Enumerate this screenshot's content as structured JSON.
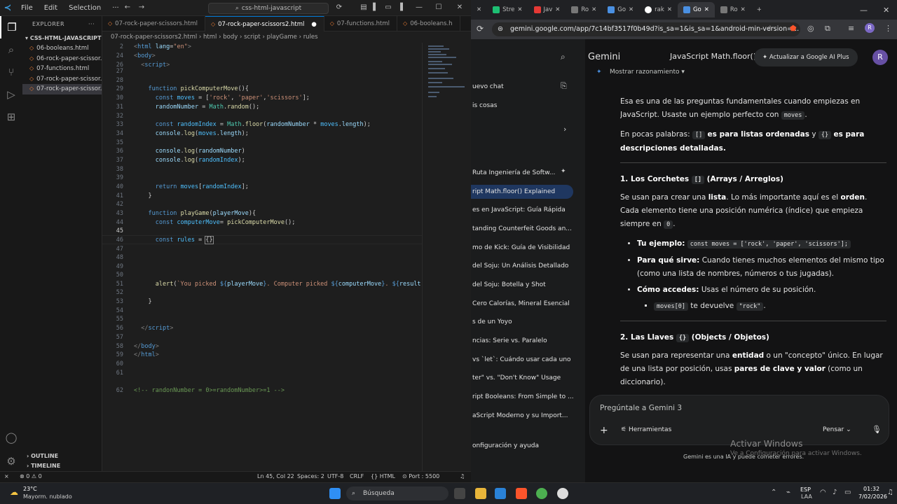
{
  "vscode": {
    "menu": [
      "File",
      "Edit",
      "Selection",
      "···"
    ],
    "search": "css-html-javascript",
    "explorer": {
      "header": "EXPLORER",
      "folder": "CSS-HTML-JAVASCRIPT",
      "files": [
        "06-booleans.html",
        "06-rock-paper-scissor...",
        "07-functions.html",
        "07-rock-paper-scissor...",
        "07-rock-paper-scissor..."
      ],
      "outline": "OUTLINE",
      "timeline": "TIMELINE"
    },
    "tabs": [
      "07-rock-paper-scissors.html",
      "07-rock-paper-scissors2.html",
      "07-functions.html",
      "06-booleans.h"
    ],
    "breadcrumb": [
      "07-rock-paper-scissors2.html",
      "html",
      "body",
      "script",
      "playGame",
      "rules"
    ],
    "line_numbers": [
      "2",
      "24",
      "26",
      "27",
      "28",
      "29",
      "30",
      "31",
      "32",
      "33",
      "34",
      "35",
      "36",
      "37",
      "38",
      "39",
      "40",
      "41",
      "42",
      "43",
      "44",
      "45",
      "46",
      "47",
      "48",
      "49",
      "50",
      "51",
      "52",
      "53",
      "54",
      "55",
      "56",
      "57",
      "58",
      "59",
      "60",
      "61",
      "62"
    ],
    "current_line": "45",
    "status": {
      "errors": "⊗ 0 ⚠ 0",
      "position": "Ln 45, Col 22",
      "spaces": "Spaces: 2",
      "encoding": "UTF-8",
      "eol": "CRLF",
      "language": "{} HTML",
      "port": "Port : 5500"
    }
  },
  "browser": {
    "tabs": [
      "Stre",
      "Jav",
      "Ro",
      "Go",
      "rak",
      "Go",
      "Ro"
    ],
    "url": "gemini.google.com/app/7c14bf3517f0b49d?is_sa=1&is_sa=1&android-min-version=..."
  },
  "gemini": {
    "brand": "Gemini",
    "chat_title": "JavaScript Math.floor()",
    "upgrade": "Actualizar a Google AI Plus",
    "avatar": "R",
    "new_chat": "uevo chat",
    "gems": "is cosas",
    "history": [
      "Ruta Ingeniería de Softw...",
      "ript Math.floor() Explained",
      "es en JavaScript: Guía Rápida",
      "tanding Counterfeit Goods an...",
      "mo de Kick: Guía de Visibilidad",
      "del Soju: Un Análisis Detallado",
      "del Soju: Botella y Shot",
      "Cero Calorías, Mineral Esencial",
      "s de un Yoyo",
      "ncias: Serie vs. Paralelo",
      "vs `let`: Cuándo usar cada uno",
      "ter\" vs. \"Don't Know\" Usage",
      "ript Booleans: From Simple to ...",
      "aScript Moderno y su Import...",
      "onfiguración y ayuda"
    ],
    "show_reasoning": "Mostrar razonamiento",
    "prompt_placeholder": "Pregúntale a Gemini 3",
    "tools": "Herramientas",
    "mode": "Pensar",
    "disclaimer": "Gemini es una IA y puede cometer errores.",
    "watermark_title": "Activar Windows",
    "watermark_sub": "Ve a Configuración para activar Windows."
  },
  "taskbar": {
    "weather_temp": "23°C",
    "weather_desc": "Mayorm. nublado",
    "search": "Búsqueda",
    "lang": "ESP",
    "lang2": "LAA",
    "time": "01:32",
    "date": "7/02/2026"
  }
}
